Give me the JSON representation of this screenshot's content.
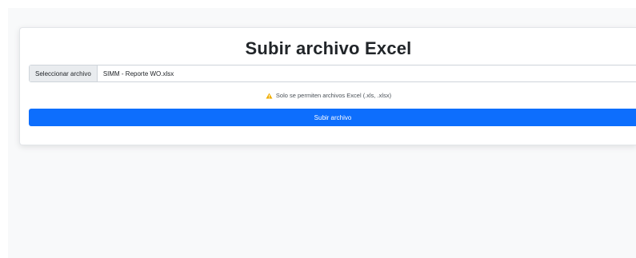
{
  "form": {
    "title": "Subir archivo Excel",
    "file_button_label": "Seleccionar archivo",
    "file_name": "SIMM - Reporte WO.xlsx",
    "warning_text": "Solo se permiten archivos Excel (.xls, .xlsx)",
    "submit_label": "Subir archivo"
  },
  "colors": {
    "primary": "#0d6efd",
    "warning": "#f0ad00",
    "background": "#f8f9fa"
  },
  "icons": {
    "warning": "warning-triangle-icon"
  }
}
